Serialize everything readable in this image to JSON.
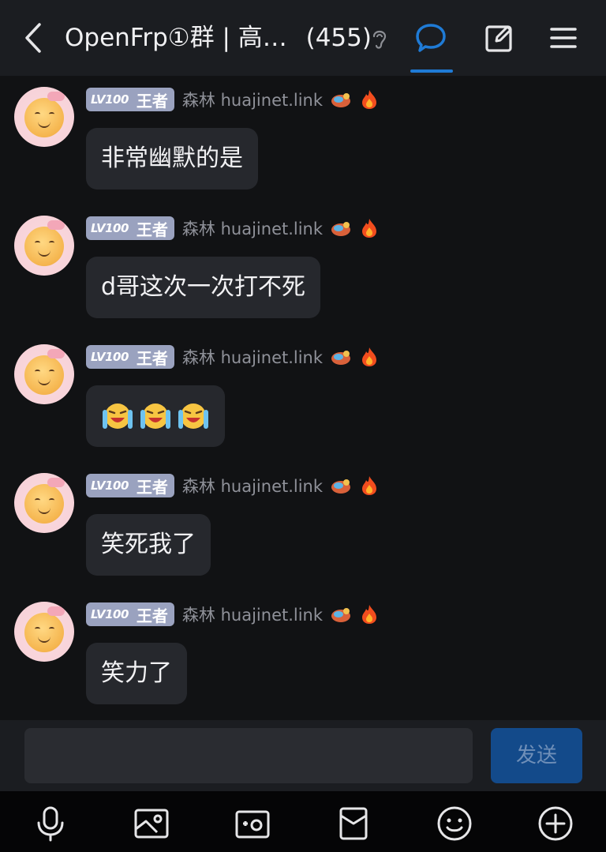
{
  "header": {
    "title": "OpenFrp①群 | 高…",
    "member_count": "(455)"
  },
  "messages": [
    {
      "badge_level": "LV100",
      "badge_rank": "王者",
      "sender": "森林 huajinet.link",
      "text": "非常幽默的是"
    },
    {
      "badge_level": "LV100",
      "badge_rank": "王者",
      "sender": "森林 huajinet.link",
      "text": "d哥这次一次打不死"
    },
    {
      "badge_level": "LV100",
      "badge_rank": "王者",
      "sender": "森林 huajinet.link",
      "text": "",
      "emojis": [
        "laugh-cry-emoji",
        "laugh-cry-emoji",
        "laugh-cry-emoji"
      ]
    },
    {
      "badge_level": "LV100",
      "badge_rank": "王者",
      "sender": "森林 huajinet.link",
      "text": "笑死我了"
    },
    {
      "badge_level": "LV100",
      "badge_rank": "王者",
      "sender": "森林 huajinet.link",
      "text": "笑力了"
    }
  ],
  "composer": {
    "value": "",
    "send_label": "发送"
  },
  "colors": {
    "background": "#111214",
    "bar": "#1b1d21",
    "bubble": "#26282d",
    "accent": "#1f7bd6",
    "badge": "#9aa2bf",
    "send_button": "#134a8a"
  },
  "icons": {
    "top": [
      "back-icon",
      "ear-icon",
      "chat-icon",
      "edit-icon",
      "menu-icon"
    ],
    "bottom": [
      "microphone-icon",
      "image-icon",
      "camera-icon",
      "red-packet-icon",
      "smile-icon",
      "plus-icon"
    ]
  }
}
